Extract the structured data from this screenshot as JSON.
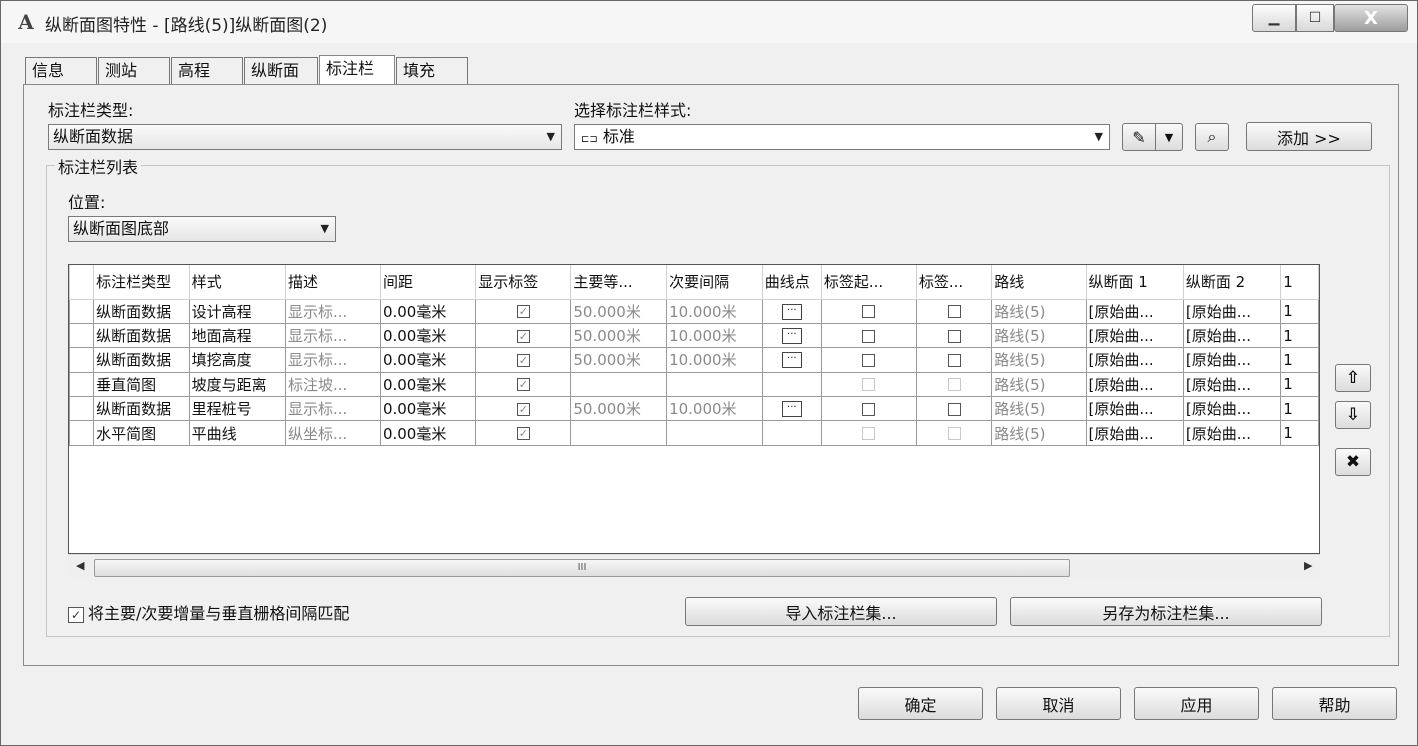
{
  "window": {
    "title": "纵断面图特性 - [路线(5)]纵断面图(2)",
    "app_icon": "A",
    "close_glyph": "X"
  },
  "tabs": [
    "信息",
    "测站",
    "高程",
    "纵断面",
    "标注栏",
    "填充"
  ],
  "band_type": {
    "label": "标注栏类型:",
    "value": "纵断面数据"
  },
  "band_style": {
    "label": "选择标注栏样式:",
    "value": "标准"
  },
  "add_button": "添加 >>",
  "band_list": {
    "title": "标注栏列表",
    "location_label": "位置:",
    "location_value": "纵断面图底部",
    "columns": [
      "标注栏类型",
      "样式",
      "描述",
      "间距",
      "显示标签",
      "主要等...",
      "次要间隔",
      "曲线点",
      "标签起...",
      "标签...",
      "路线",
      "纵断面 1",
      "纵断面 2",
      "1"
    ],
    "rows": [
      {
        "type": "纵断面数据",
        "style": "设计高程",
        "desc": "显示标...",
        "gap": "0.00毫米",
        "show": "checked",
        "major": "50.000米",
        "minor": "10.000米",
        "curve": true,
        "lbl_start": "empty",
        "lbl_end": "empty",
        "align": "路线(5)",
        "prof1": "[原始曲...",
        "prof2": "[原始曲...",
        "more": "1"
      },
      {
        "type": "纵断面数据",
        "style": "地面高程",
        "desc": "显示标...",
        "gap": "0.00毫米",
        "show": "checked",
        "major": "50.000米",
        "minor": "10.000米",
        "curve": true,
        "lbl_start": "empty",
        "lbl_end": "empty",
        "align": "路线(5)",
        "prof1": "[原始曲...",
        "prof2": "[原始曲...",
        "more": "1"
      },
      {
        "type": "纵断面数据",
        "style": "填挖高度",
        "desc": "显示标...",
        "gap": "0.00毫米",
        "show": "checked",
        "major": "50.000米",
        "minor": "10.000米",
        "curve": true,
        "lbl_start": "empty",
        "lbl_end": "empty",
        "align": "路线(5)",
        "prof1": "[原始曲...",
        "prof2": "[原始曲...",
        "more": "1"
      },
      {
        "type": "垂直简图",
        "style": "坡度与距离",
        "desc": "标注坡...",
        "gap": "0.00毫米",
        "show": "checked",
        "major": "",
        "minor": "",
        "curve": false,
        "lbl_start": "disabled",
        "lbl_end": "disabled",
        "align": "路线(5)",
        "prof1": "[原始曲...",
        "prof2": "[原始曲...",
        "more": "1"
      },
      {
        "type": "纵断面数据",
        "style": "里程桩号",
        "desc": "显示标...",
        "gap": "0.00毫米",
        "show": "checked",
        "major": "50.000米",
        "minor": "10.000米",
        "curve": true,
        "lbl_start": "empty",
        "lbl_end": "empty",
        "align": "路线(5)",
        "prof1": "[原始曲...",
        "prof2": "[原始曲...",
        "more": "1"
      },
      {
        "type": "水平简图",
        "style": "平曲线",
        "desc": "纵坐标...",
        "gap": "0.00毫米",
        "show": "checked",
        "major": "",
        "minor": "",
        "curve": false,
        "lbl_start": "disabled",
        "lbl_end": "disabled",
        "align": "路线(5)",
        "prof1": "[原始曲...",
        "prof2": "[原始曲...",
        "more": "1"
      }
    ],
    "scroll_grip": "III"
  },
  "match_checkbox": {
    "label": "将主要/次要增量与垂直栅格间隔匹配",
    "checked": true
  },
  "import_button": "导入标注栏集...",
  "saveas_button": "另存为标注栏集...",
  "footer": {
    "ok": "确定",
    "cancel": "取消",
    "apply": "应用",
    "help": "帮助"
  }
}
